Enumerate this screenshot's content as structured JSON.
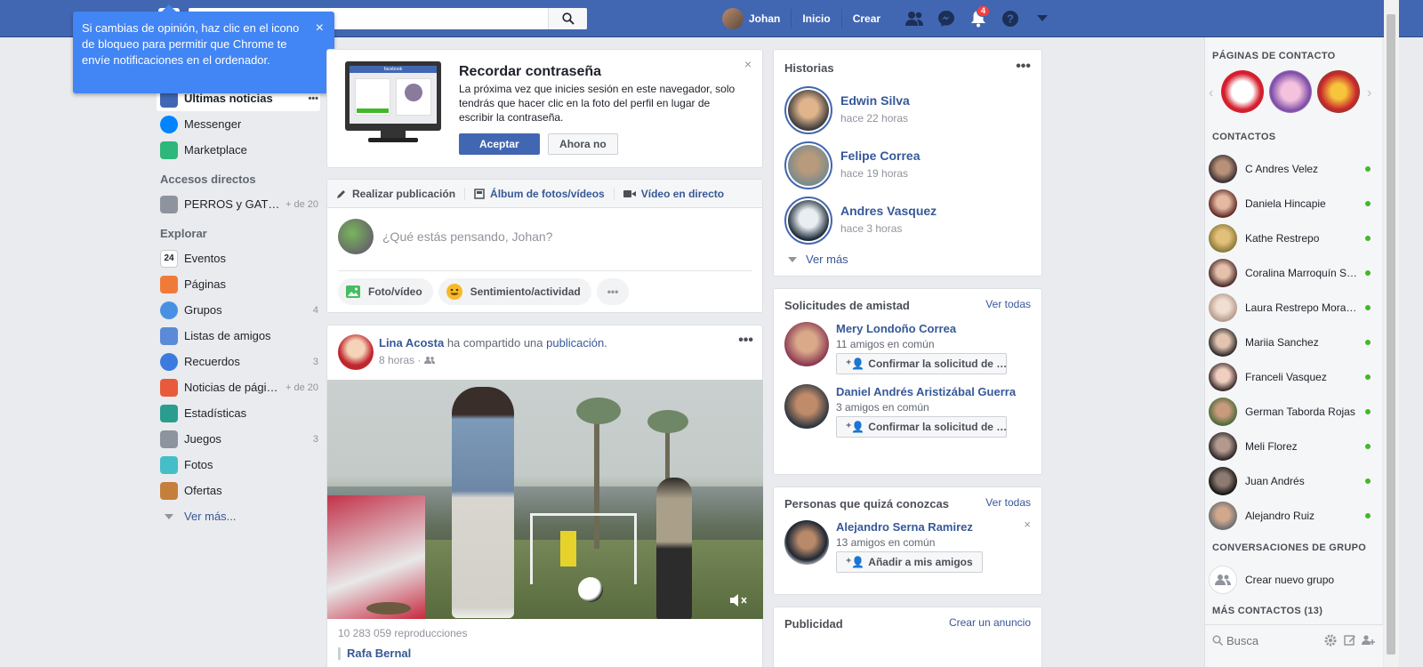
{
  "tooltip": {
    "text": "Si cambias de opinión, haz clic en el icono de bloqueo para permitir que Chrome te envíe notificaciones en el ordenador.",
    "close": "×"
  },
  "header": {
    "search_placeholder": "",
    "user_name": "Johan",
    "home_label": "Inicio",
    "create_label": "Crear",
    "notifications_badge": "4",
    "help_label": "?"
  },
  "left_nav": {
    "news_feed_label": "Últimas noticias",
    "items_top": [
      {
        "label": "Messenger",
        "count": ""
      },
      {
        "label": "Marketplace",
        "count": ""
      }
    ],
    "shortcuts_heading": "Accesos directos",
    "shortcuts": [
      {
        "label": "PERROS y GAT…",
        "count": "+ de 20"
      }
    ],
    "explore_heading": "Explorar",
    "explore": [
      {
        "label": "Eventos",
        "count": ""
      },
      {
        "label": "Páginas",
        "count": ""
      },
      {
        "label": "Grupos",
        "count": "4"
      },
      {
        "label": "Listas de amigos",
        "count": ""
      },
      {
        "label": "Recuerdos",
        "count": "3"
      },
      {
        "label": "Noticias de pági…",
        "count": "+ de 20"
      },
      {
        "label": "Estadísticas",
        "count": ""
      },
      {
        "label": "Juegos",
        "count": "3"
      },
      {
        "label": "Fotos",
        "count": ""
      },
      {
        "label": "Ofertas",
        "count": ""
      }
    ],
    "see_more": "Ver más..."
  },
  "password_card": {
    "title": "Recordar contraseña",
    "body": "La próxima vez que inicies sesión en este navegador, solo tendrás que hacer clic en la foto del perfil en lugar de escribir la contraseña.",
    "accept": "Aceptar",
    "decline": "Ahora no",
    "monitor_brand": "facebook"
  },
  "composer": {
    "tab_post": "Realizar publicación",
    "tab_album": "Álbum de fotos/vídeos",
    "tab_live": "Vídeo en directo",
    "placeholder": "¿Qué estás pensando, Johan?",
    "chip_photo": "Foto/vídeo",
    "chip_feeling": "Sentimiento/actividad",
    "chip_more": "•••"
  },
  "post": {
    "author": "Lina Acosta",
    "action": "ha compartido una",
    "object": "publicación.",
    "time": "8 horas ·",
    "views": "10 283 059 reproducciones",
    "next_author": "Rafa Bernal"
  },
  "stories": {
    "title": "Historias",
    "items": [
      {
        "name": "Edwin Silva",
        "time": "hace 22 horas"
      },
      {
        "name": "Felipe Correa",
        "time": "hace 19 horas"
      },
      {
        "name": "Andres Vasquez",
        "time": "hace 3 horas"
      }
    ],
    "see_more": "Ver más"
  },
  "friend_requests": {
    "title": "Solicitudes de amistad",
    "see_all": "Ver todas",
    "items": [
      {
        "name": "Mery Londoño Correa",
        "mutual": "11 amigos en común",
        "button": "Confirmar la solicitud de …"
      },
      {
        "name": "Daniel Andrés Aristizábal Guerra",
        "mutual": "3 amigos en común",
        "button": "Confirmar la solicitud de …"
      }
    ]
  },
  "people_you_may_know": {
    "title": "Personas que quizá conozcas",
    "see_all": "Ver todas",
    "name": "Alejandro Serna Ramirez",
    "mutual": "13 amigos en común",
    "button": "Añadir a mis amigos"
  },
  "ads": {
    "title": "Publicidad",
    "create": "Crear un anuncio"
  },
  "sidebar": {
    "pages_heading": "PÁGINAS DE CONTACTO",
    "contacts_heading": "CONTACTOS",
    "contacts": [
      "C Andres Velez",
      "Daniela Hincapie",
      "Kathe Restrepo",
      "Coralina Marroquín S…",
      "Laura Restrepo Mora…",
      "Mariia Sanchez",
      "Franceli Vasquez",
      "German Taborda Rojas",
      "Meli Florez",
      "Juan Andrés",
      "Alejandro Ruiz"
    ],
    "group_heading": "CONVERSACIONES DE GRUPO",
    "new_group": "Crear nuevo grupo",
    "more_contacts": "MÁS CONTACTOS (13)",
    "search_placeholder": "Busca"
  },
  "colors": {
    "brand": "#4267b2",
    "link": "#365899",
    "online": "#42b72a",
    "tooltip": "#4285f4"
  }
}
